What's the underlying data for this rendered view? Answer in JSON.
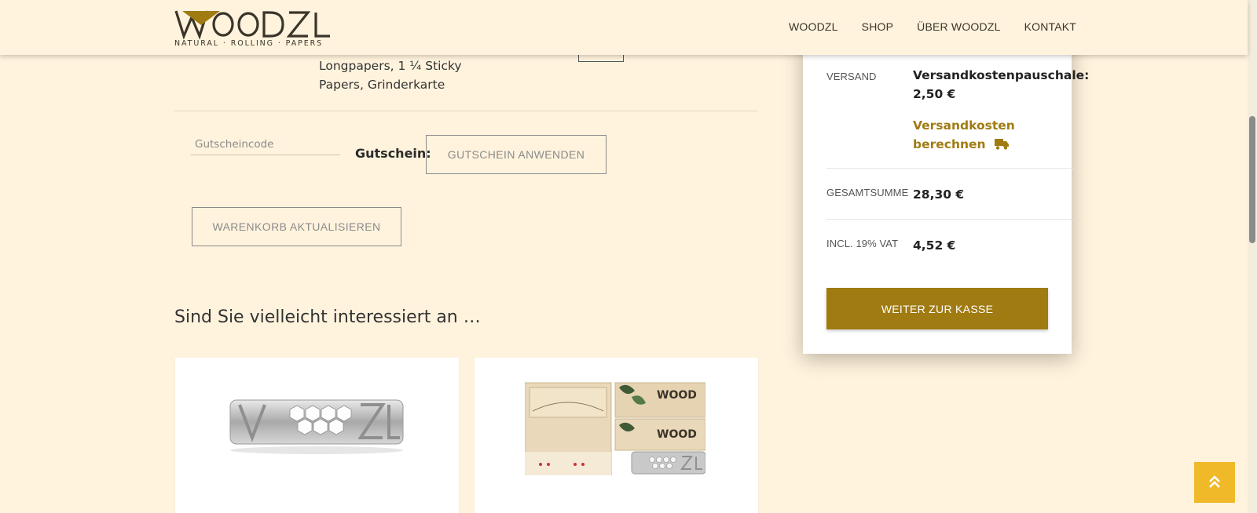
{
  "brand": {
    "logo_text": "WOODZL",
    "tagline": "NATURAL · ROLLING · PAPERS"
  },
  "nav": {
    "items": [
      "WOODZL",
      "SHOP",
      "ÜBER WOODZL",
      "KONTAKT"
    ]
  },
  "cart": {
    "product_description": "Longpapers, 1 ¼ Sticky Papers, Grinderkarte",
    "coupon": {
      "placeholder": "Gutscheincode",
      "label": "Gutschein:",
      "apply_label": "GUTSCHEIN ANWENDEN"
    },
    "update_label": "WARENKORB AKTUALISIEREN"
  },
  "related": {
    "title": "Sind Sie vielleicht interessiert an …"
  },
  "totals": {
    "shipping_label": "VERSAND",
    "shipping_value": "Versandkostenpauschale: 2,50 €",
    "shipping_calc_link": "Versandkosten berechnen",
    "total_label": "GESAMTSUMME",
    "total_value": "28,30 €",
    "vat_label": "INCL. 19% VAT",
    "vat_value": "4,52 €",
    "checkout_label": "WEITER ZUR KASSE"
  },
  "colors": {
    "background": "#fff3dd",
    "accent": "#a07b12",
    "back_to_top": "#f0b929"
  },
  "icons": {
    "truck": "truck-icon",
    "back_to_top": "chevron-double-up-icon"
  }
}
